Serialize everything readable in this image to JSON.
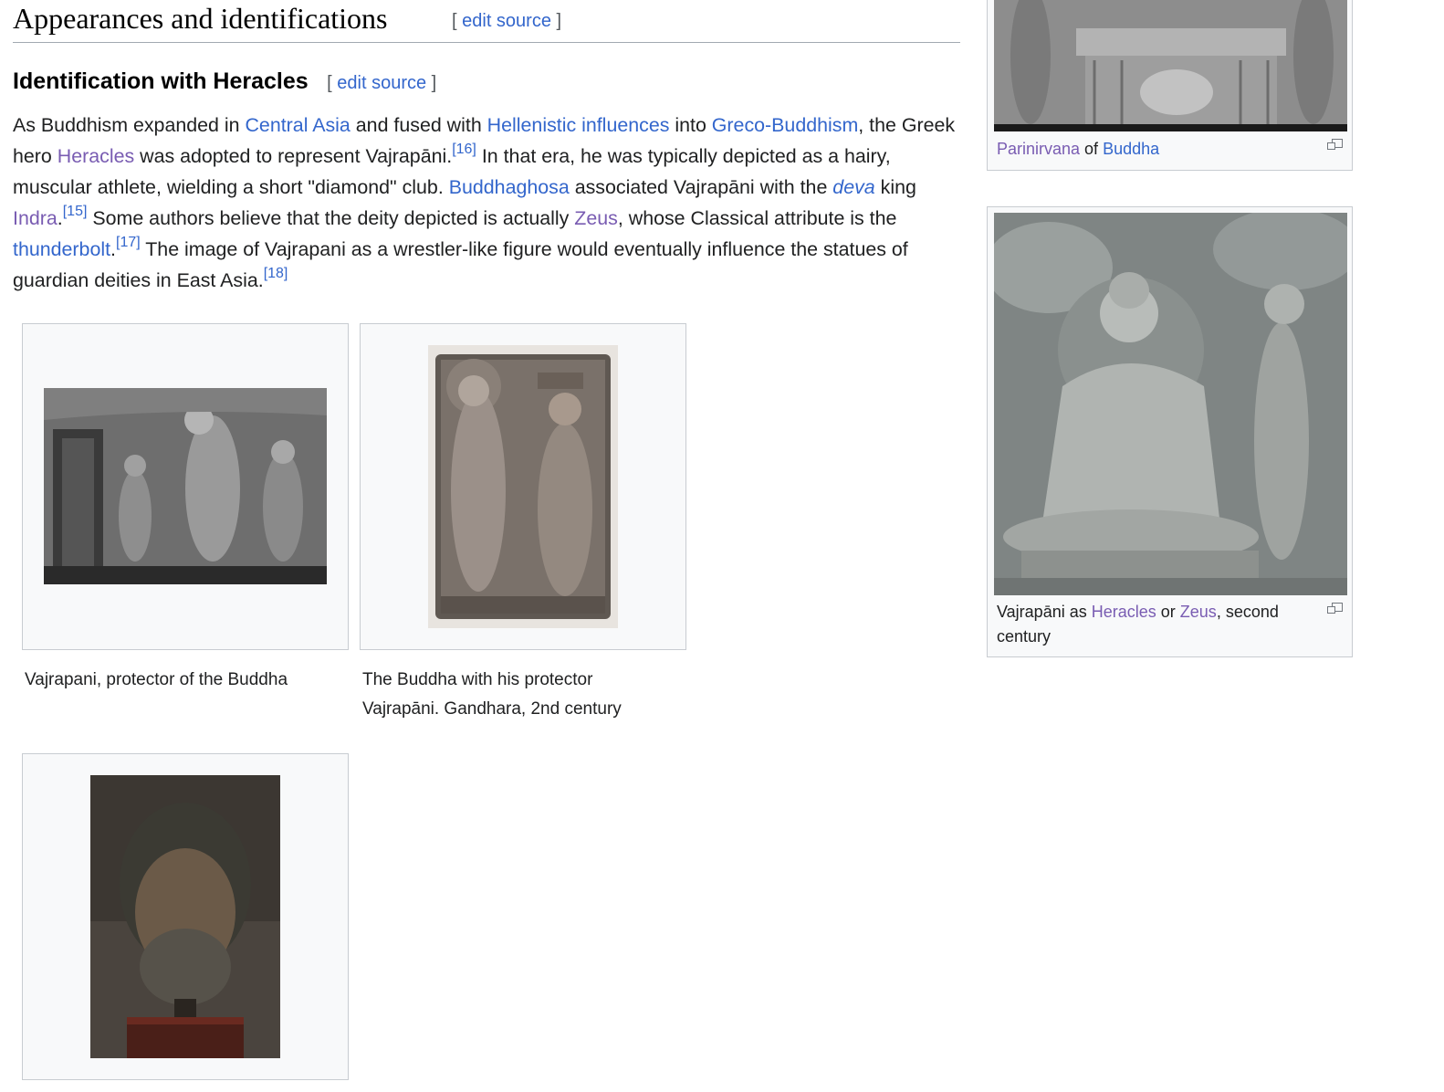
{
  "section": {
    "title": "Appearances and identifications",
    "edit_label": "edit source"
  },
  "subsection": {
    "title": "Identification with Heracles",
    "edit_label": "edit source"
  },
  "paragraph": {
    "s1": "As Buddhism expanded in ",
    "link_central_asia": "Central Asia",
    "s2": " and fused with ",
    "link_hellenistic": "Hellenistic influences",
    "s3": " into ",
    "link_greco": "Greco-Buddhism",
    "s4": ", the Greek hero ",
    "link_heracles": "Heracles",
    "s5": " was adopted to represent Vajrapāni.",
    "ref16": "[16]",
    "s6": " In that era, he was typically depicted as a hairy, muscular athlete, wielding a short \"diamond\" club. ",
    "link_buddhaghosa": "Buddhaghosa",
    "s7": " associated Vajrapāni with the ",
    "link_deva": "deva",
    "s8": " king ",
    "link_indra": "Indra",
    "s9": ".",
    "ref15": "[15]",
    "s10": " Some authors believe that the deity depicted is actually ",
    "link_zeus": "Zeus",
    "s11": ", whose Classical attribute is the ",
    "link_thunderbolt": "thunderbolt",
    "s12": ".",
    "ref17": "[17]",
    "s13": " The image of Vajrapani as a wrestler-like figure would eventually influence the statues of guardian deities in East Asia.",
    "ref18": "[18]"
  },
  "gallery": [
    {
      "caption": "Vajrapani, protector of the Buddha"
    },
    {
      "caption": "The Buddha with his protector Vajrapāni. Gandhara, 2nd century"
    },
    {
      "caption": ""
    }
  ],
  "thumb_top": {
    "link1": "Parinirvana",
    "mid": " of ",
    "link2": "Buddha"
  },
  "thumb_bottom": {
    "s1": "Vajrapāni as ",
    "link1": "Heracles",
    "s2": " or ",
    "link2": "Zeus",
    "s3": ", second century"
  },
  "colors": {
    "link": "#3366cc",
    "visited_link": "#795cb2",
    "text": "#202122"
  }
}
